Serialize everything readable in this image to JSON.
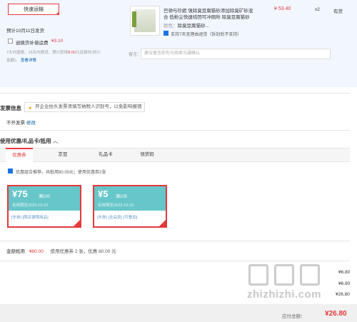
{
  "shipping": {
    "button_label": "快速运输",
    "estimate": "预计10月11日发货",
    "option_label": "退换货补偿运费",
    "option_price": "¥3.10",
    "desc_line1": "7天内退换、15天内换货，预计获得",
    "desc_highlight": "8.00",
    "desc_line1_end": "元运费时(到小",
    "desc_line2": "金额)。",
    "details_link": "查看详情"
  },
  "item": {
    "title_line1": "巴顿与珍妮 强除臭豆腐猫砂添加除臭矿砂混",
    "title_line2": "合 低粉尘快速结团可冲厕所 除臭豆腐猫砂",
    "price": "¥ 53.40",
    "qty": "x2",
    "stock": "有货",
    "color_label": "颜色：",
    "color_value": "除臭豆腐猫砂...",
    "return_policy": "支持7天无理由退货（拆封后不支持）",
    "note_label": "留言：",
    "note_placeholder": "建议留言前先与商家沟通确认"
  },
  "invoice": {
    "title": "发票信息",
    "tip": "开企业抬头发票须填写纳税人识别号，以免影响报销",
    "value": "不开发票",
    "edit_link": "修改"
  },
  "coupons": {
    "section_title": "使用优惠/礼品卡/抵用",
    "tabs": [
      "优惠券",
      "京豆",
      "礼品卡",
      "领货码"
    ],
    "recommend_text": "优惠组合推荐，共抵用80.00元；使用优惠券2张",
    "items": [
      {
        "amount": "¥75",
        "condition": "满100",
        "expiry": "有效期至2023-10-10",
        "tags": "[东券] [限店铺限商品]"
      },
      {
        "amount": "¥5",
        "condition": "满105",
        "expiry": "有效期至2023-10-10",
        "tags": "[东券] [全品类] [可叠加]"
      }
    ],
    "summary_label": "金额抵用",
    "summary_amount": "¥80.00",
    "summary_detail": "使用优惠券 2 张，优惠 80.00 元"
  },
  "totals": {
    "lines": [
      "¥6.80",
      "¥6.80",
      "¥26.80"
    ],
    "payable_label": "应付总额：",
    "payable_amount": "¥26.80"
  },
  "watermark": {
    "text": "zhizhizhi.com",
    "logo": "值值值"
  },
  "colors": {
    "accent": "#e4393c",
    "coupon_bg": "#67c6c9",
    "link": "#005aa0"
  }
}
